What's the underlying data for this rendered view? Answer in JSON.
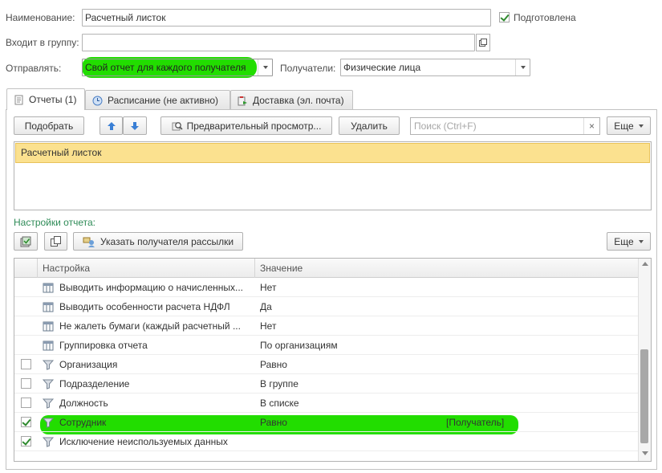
{
  "form": {
    "name_label": "Наименование:",
    "name_value": "Расчетный листок",
    "prepared_label": "Подготовлена",
    "prepared_checked": true,
    "group_label": "Входит в группу:",
    "group_value": "",
    "send_label": "Отправлять:",
    "send_value": "Свой отчет для каждого получателя",
    "recipients_label": "Получатели:",
    "recipients_value": "Физические лица"
  },
  "tabs": [
    {
      "label": "Отчеты (1)",
      "icon": "report-icon",
      "active": true
    },
    {
      "label": "Расписание (не активно)",
      "icon": "schedule-icon",
      "active": false
    },
    {
      "label": "Доставка (эл. почта)",
      "icon": "delivery-icon",
      "active": false
    }
  ],
  "toolbar": {
    "pick_label": "Подобрать",
    "preview_label": "Предварительный просмотр...",
    "delete_label": "Удалить",
    "search_placeholder": "Поиск (Ctrl+F)",
    "more_label": "Еще"
  },
  "reports": [
    "Расчетный листок"
  ],
  "settings": {
    "title": "Настройки отчета:",
    "specify_recipient_label": "Указать получателя рассылки",
    "more_label": "Еще",
    "columns": [
      "Настройка",
      "Значение"
    ],
    "rows": [
      {
        "checkbox": null,
        "icon": "table-icon",
        "name": "Выводить информацию о начисленных...",
        "value": "Нет",
        "extra": ""
      },
      {
        "checkbox": null,
        "icon": "table-icon",
        "name": "Выводить особенности расчета НДФЛ",
        "value": "Да",
        "extra": ""
      },
      {
        "checkbox": null,
        "icon": "table-icon",
        "name": "Не жалеть бумаги (каждый расчетный ...",
        "value": "Нет",
        "extra": ""
      },
      {
        "checkbox": null,
        "icon": "table-icon",
        "name": "Группировка отчета",
        "value": "По организациям",
        "extra": ""
      },
      {
        "checkbox": false,
        "icon": "filter-icon",
        "name": "Организация",
        "value": "Равно",
        "extra": ""
      },
      {
        "checkbox": false,
        "icon": "filter-icon",
        "name": "Подразделение",
        "value": "В группе",
        "extra": ""
      },
      {
        "checkbox": false,
        "icon": "filter-icon",
        "name": "Должность",
        "value": "В списке",
        "extra": ""
      },
      {
        "checkbox": true,
        "icon": "filter-icon",
        "name": "Сотрудник",
        "value": "Равно",
        "extra": "[Получатель]"
      },
      {
        "checkbox": true,
        "icon": "filter-icon",
        "name": "Исключение неиспользуемых данных",
        "value": "",
        "extra": ""
      }
    ]
  },
  "colors": {
    "highlight": "#22dd00",
    "selection": "#fbe18f",
    "settings_title": "#2e8b57",
    "arrow_blue": "#3a7fd5"
  }
}
